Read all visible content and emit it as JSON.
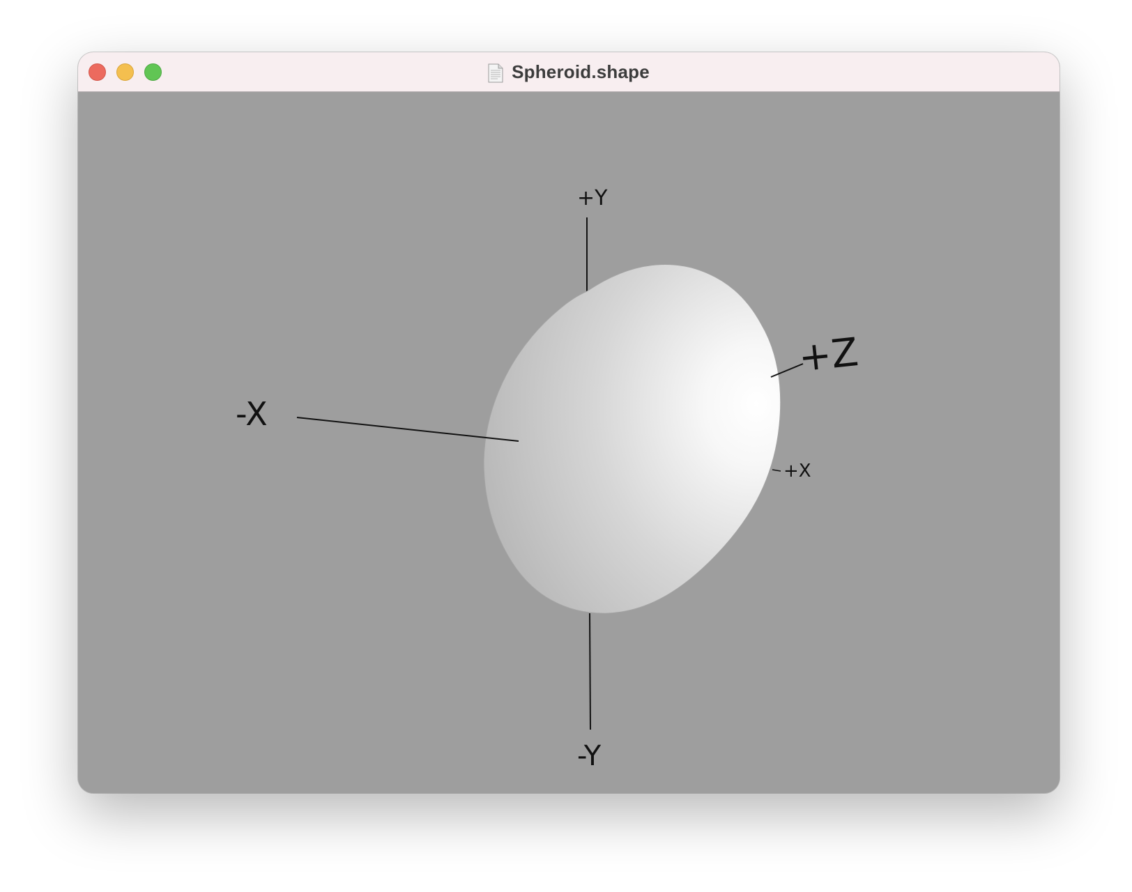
{
  "window": {
    "title": "Spheroid.shape",
    "document_icon": "document-icon"
  },
  "traffic_lights": {
    "close_color": "#ec6a5e",
    "minimize_color": "#f4bf4f",
    "zoom_color": "#61c554"
  },
  "viewport": {
    "background_color": "#9e9e9e",
    "shape": "spheroid",
    "axis_labels": {
      "plus_y": "+Y",
      "minus_y": "-Y",
      "minus_x": "-X",
      "plus_x": "+X",
      "plus_z": "+Z"
    }
  }
}
